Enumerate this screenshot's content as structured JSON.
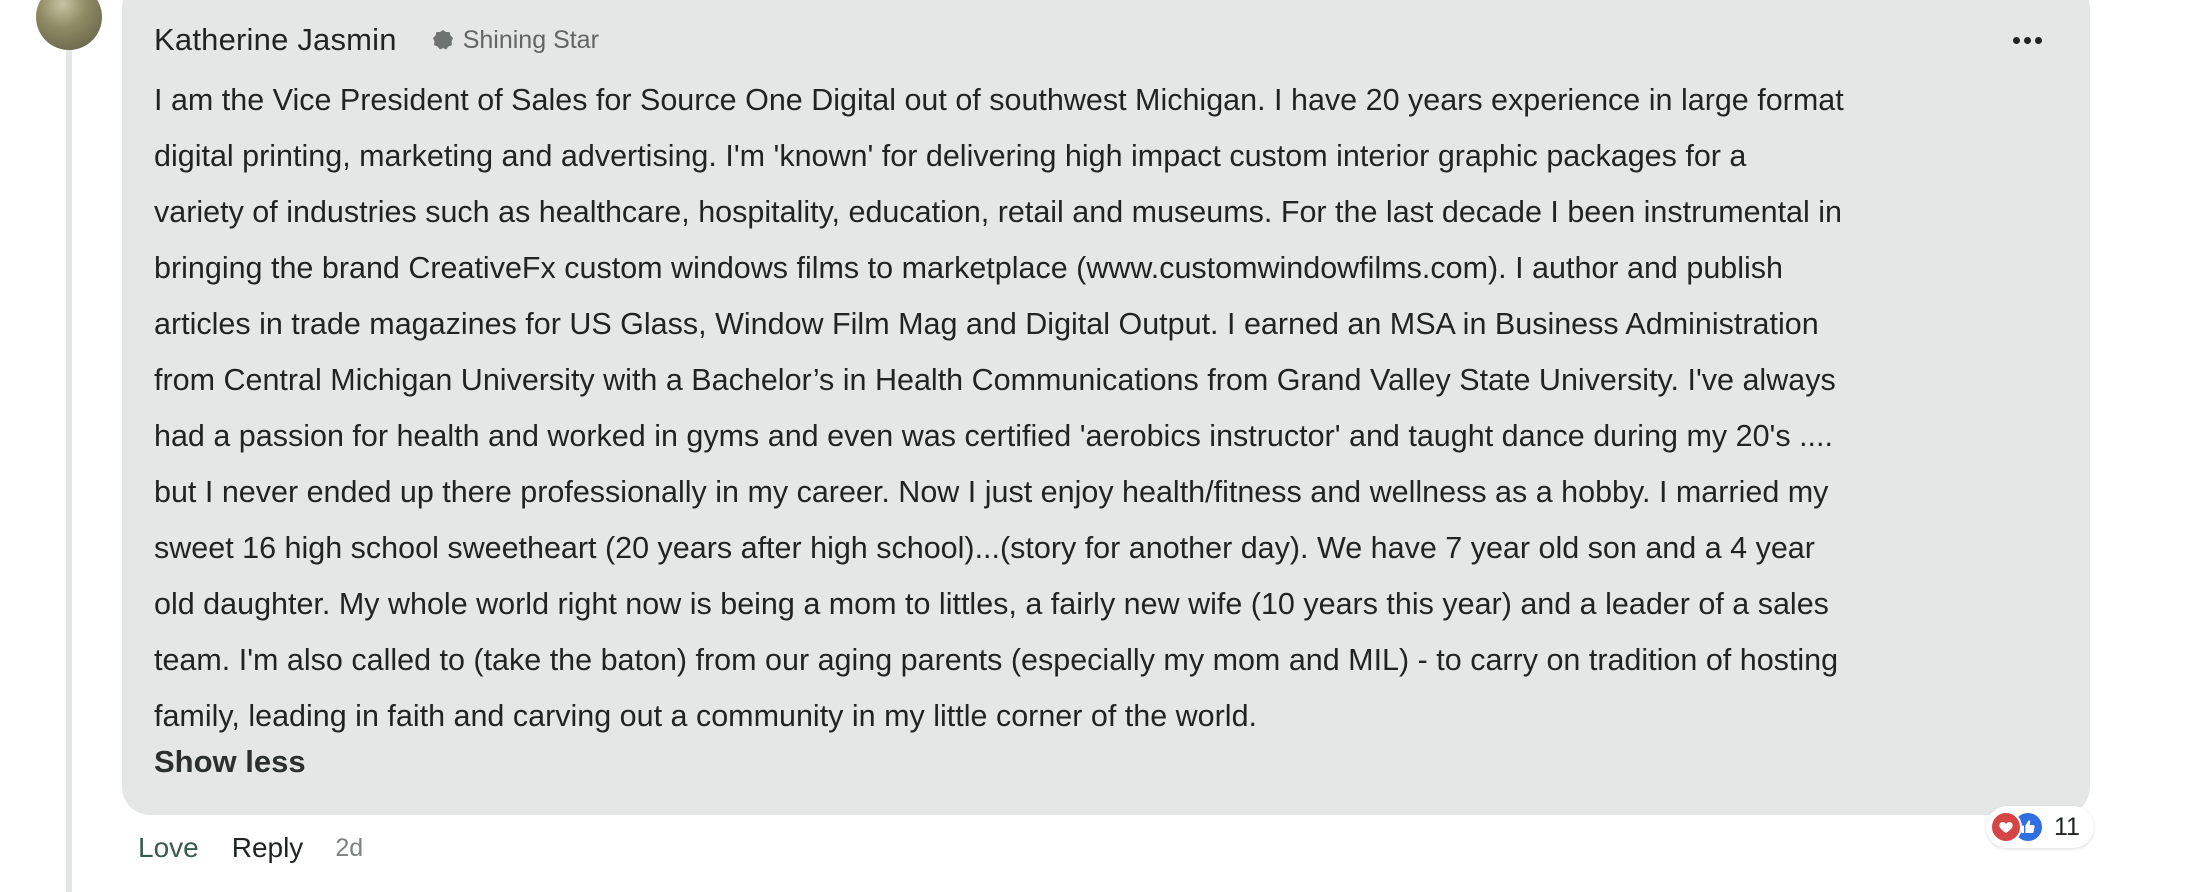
{
  "comment": {
    "author": "Katherine Jasmin",
    "badge": "Shining Star",
    "body_lines": [
      "I am the Vice President of Sales for Source One Digital out of southwest Michigan. I have 20 years experience in large format",
      "digital printing, marketing and advertising. I'm 'known' for delivering high impact custom interior graphic packages for a",
      "variety of industries such as healthcare, hospitality, education, retail and museums. For the last decade I been instrumental in",
      "bringing the brand CreativeFx custom windows films to marketplace (www.customwindowfilms.com). I author and publish",
      "articles in trade magazines for US Glass, Window Film Mag and Digital Output. I earned an MSA in Business Administration",
      "from Central Michigan University with a Bachelor’s in Health Communications from Grand Valley State University. I've always",
      "had a passion for health and worked in gyms and even was certified 'aerobics instructor' and taught dance during my 20's ....",
      "but I never ended up there professionally in my career. Now I just enjoy health/fitness and wellness as a hobby. I married my",
      "sweet 16 high school sweetheart (20 years after high school)...(story for another day). We have 7 year old son and a 4 year",
      "old daughter. My whole world right now is being a mom to littles, a fairly new wife (10 years this year) and a leader of a sales",
      "team. I'm also called to (take the baton) from our aging parents (especially my mom and MIL) - to carry on tradition of hosting",
      "family, leading in faith and carving out a community in my little corner of the world."
    ],
    "show_less_label": "Show less",
    "actions": {
      "love_label": "Love",
      "reply_label": "Reply",
      "timestamp": "2d"
    },
    "reactions": {
      "icons": [
        "heart-icon",
        "thumbs-up-icon"
      ],
      "count": "11"
    }
  },
  "colors": {
    "bubble_bg": "#e5e7e6",
    "love_link": "#3c5a4d",
    "love_reaction": "#d64545",
    "like_reaction": "#2f6fe0"
  }
}
